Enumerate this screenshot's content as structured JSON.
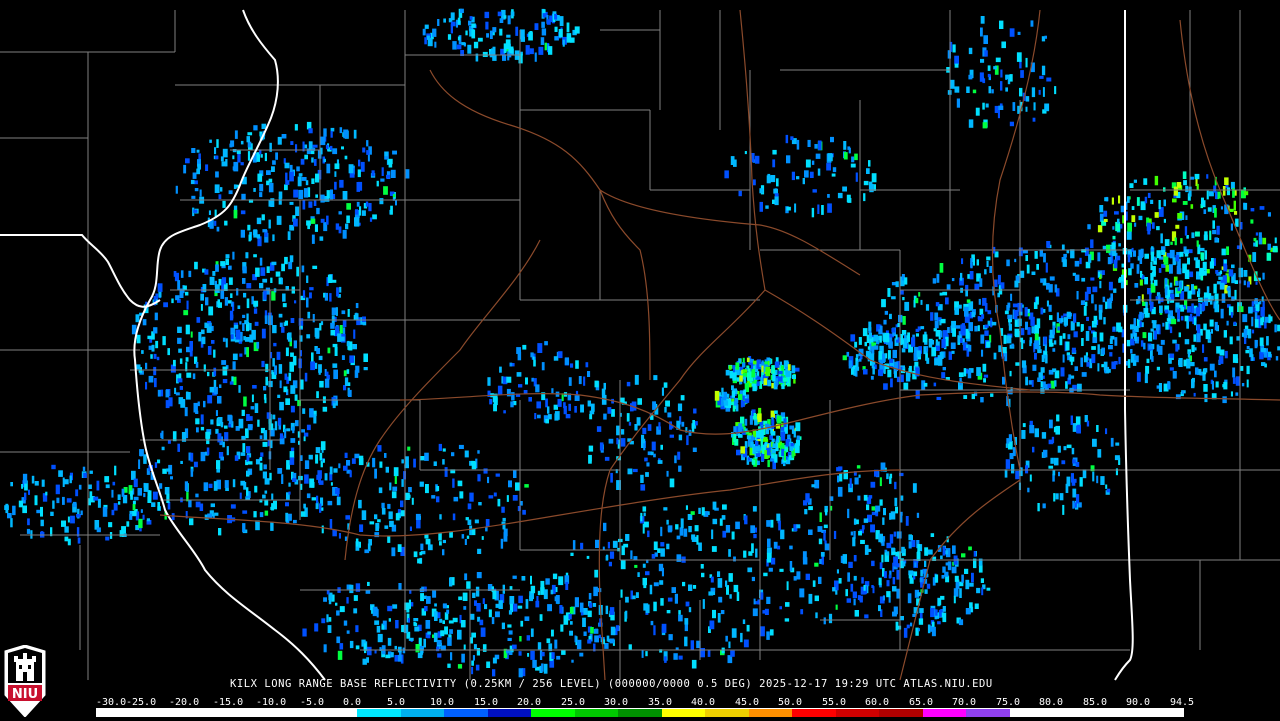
{
  "product": {
    "caption": "KILX LONG RANGE BASE REFLECTIVITY (0.25KM / 256 LEVEL) (000000/0000 0.5 DEG) 2025-12-17 19:29 UTC  ATLAS.NIU.EDU",
    "logo_text": "NIU"
  },
  "map_style": {
    "background": "#000000",
    "county_border_color": "#808080",
    "state_border_color": "#ffffff",
    "road_color": "#8b4a2b"
  },
  "scale": {
    "labels": [
      "-30.0",
      "-25.0",
      "-20.0",
      "-15.0",
      "-10.0",
      "-5.0",
      "0.0",
      "5.0",
      "10.0",
      "15.0",
      "20.0",
      "25.0",
      "30.0",
      "35.0",
      "40.0",
      "45.0",
      "50.0",
      "55.0",
      "60.0",
      "65.0",
      "70.0",
      "75.0",
      "80.0",
      "85.0",
      "90.0",
      "94.5"
    ],
    "colors": [
      "#ffffff",
      "#ffffff",
      "#ffffff",
      "#ffffff",
      "#ffffff",
      "#ffffff",
      "#00e8ff",
      "#00b0f0",
      "#0060ff",
      "#0010c0",
      "#00ff00",
      "#00c800",
      "#009000",
      "#ffff00",
      "#f0d000",
      "#ff9000",
      "#ff0000",
      "#d00000",
      "#b00000",
      "#ff00ff",
      "#9040f0",
      "#ffffff",
      "#ffffff",
      "#ffffff",
      "#ffffff"
    ]
  },
  "radar": {
    "echo_colors": [
      "#00e0ff",
      "#00b8ff",
      "#0090ff",
      "#0050ff",
      "#00ffc0",
      "#00ff40",
      "#40ff00",
      "#c0ff00",
      "#ffe000",
      "#ff2000"
    ]
  }
}
